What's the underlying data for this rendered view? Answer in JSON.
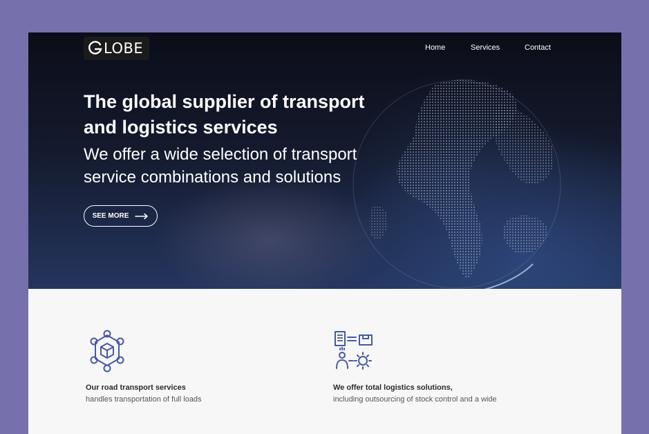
{
  "header": {
    "logo_text": "LOBE",
    "nav": {
      "home": "Home",
      "services": "Services",
      "contact": "Contact"
    }
  },
  "hero": {
    "title": "The global supplier of transport and logistics services",
    "subtitle": "We offer a wide selection of transport service combinations and solutions",
    "cta_label": "SEE MORE"
  },
  "services": [
    {
      "icon": "network-box-icon",
      "title": "Our road transport services",
      "text": "handles transportation of full loads"
    },
    {
      "icon": "logistics-gear-icon",
      "title": "We offer total logistics solutions,",
      "text": "including outsourcing of stock control and a wide"
    }
  ],
  "colors": {
    "outer_background": "#7670ac",
    "hero_dark": "#0b0d18",
    "hero_blue": "#24355e",
    "icon_blue": "#4459a3",
    "body_background": "#f7f7f8"
  }
}
